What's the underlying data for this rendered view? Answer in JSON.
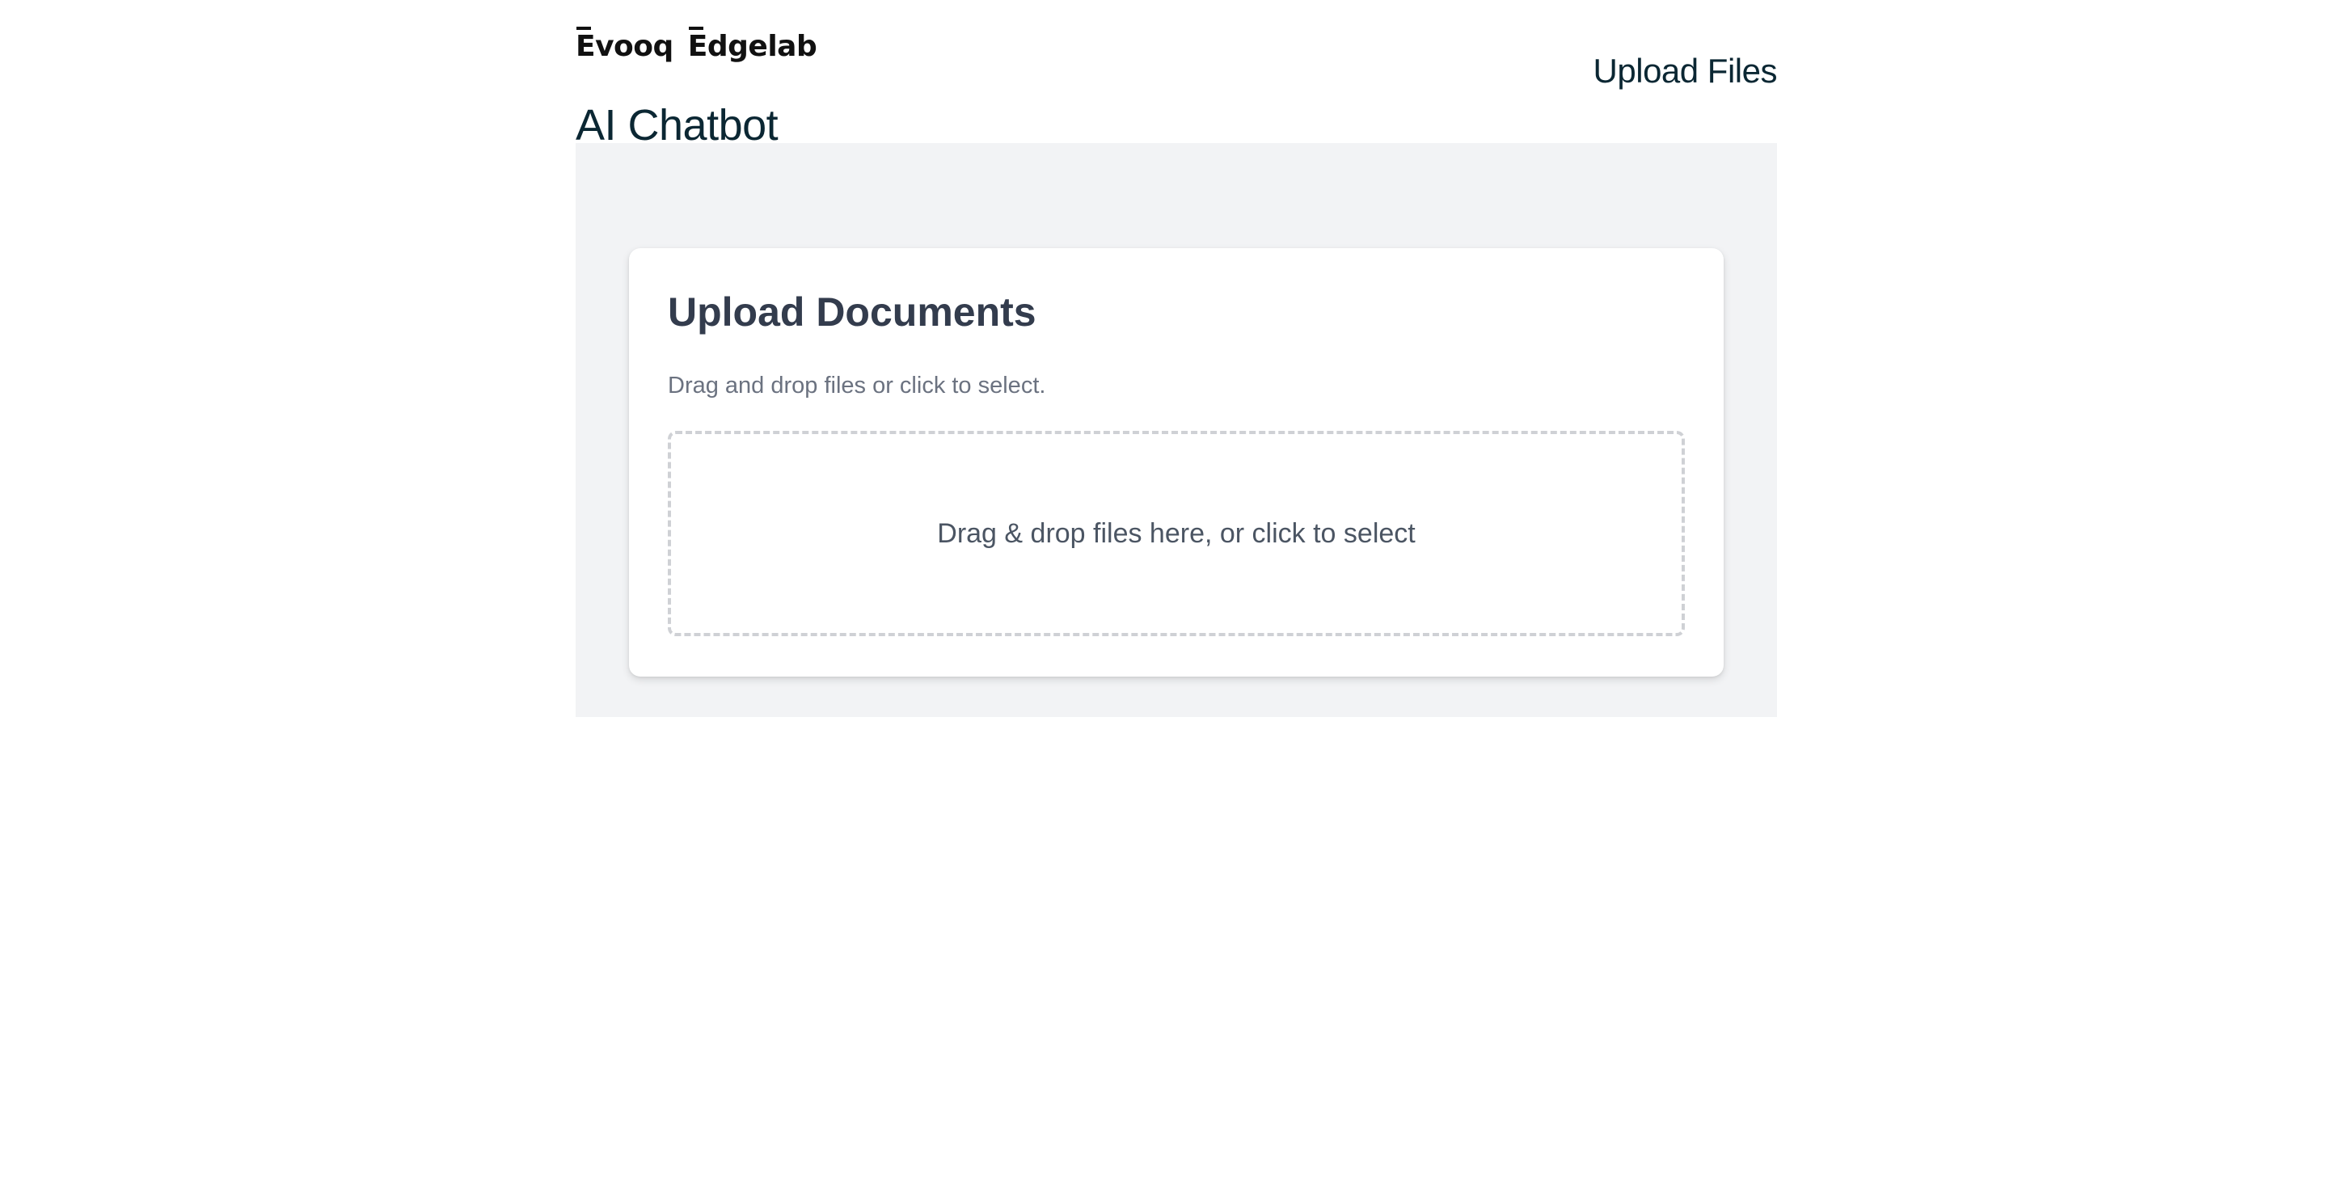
{
  "header": {
    "logo_primary": "Evooq",
    "logo_secondary": "Edgelab",
    "app_title": "AI Chatbot",
    "nav_upload_files": "Upload Files"
  },
  "upload_card": {
    "title": "Upload Documents",
    "subtitle": "Drag and drop files or click to select.",
    "dropzone_text": "Drag & drop files here, or click to select"
  },
  "colors": {
    "page_background": "#ffffff",
    "panel_background": "#f2f3f5",
    "card_background": "#ffffff",
    "title_text": "#0b2733",
    "card_title_text": "#333c4d",
    "muted_text": "#6b7280",
    "dropzone_border": "#cfd1d5"
  }
}
